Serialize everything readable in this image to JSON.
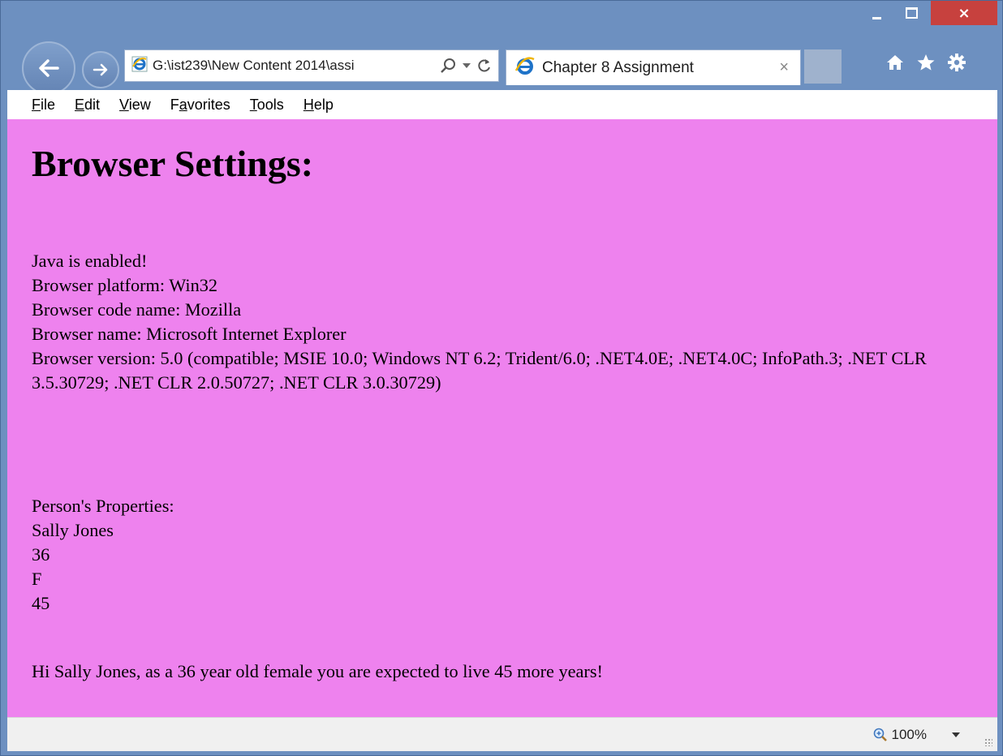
{
  "window": {
    "address": "G:\\ist239\\New Content 2014\\assi",
    "tab_title": "Chapter 8 Assignment",
    "close_glyph": "×",
    "tab_close_glyph": "×"
  },
  "menu": [
    "File",
    "Edit",
    "View",
    "Favorites",
    "Tools",
    "Help"
  ],
  "content": {
    "heading": "Browser Settings:",
    "browser_lines": [
      "Java is enabled!",
      "Browser platform: Win32",
      "Browser code name: Mozilla",
      "Browser name: Microsoft Internet Explorer",
      "Browser version: 5.0 (compatible; MSIE 10.0; Windows NT 6.2; Trident/6.0; .NET4.0E; .NET4.0C; InfoPath.3; .NET CLR 3.5.30729; .NET CLR 2.0.50727; .NET CLR 3.0.30729)"
    ],
    "person_lines": [
      "Person's Properties:",
      "Sally Jones",
      "36",
      "F",
      "45"
    ],
    "message": "Hi Sally Jones, as a 36 year old female you are expected to live 45 more years!"
  },
  "status": {
    "zoom": "100%"
  },
  "colors": {
    "page_background": "#ee82ee",
    "frame": "#6d90c0",
    "close_button": "#c7413e"
  },
  "icons": [
    "back-arrow-icon",
    "forward-arrow-icon",
    "ie-page-icon",
    "search-icon",
    "dropdown-icon",
    "refresh-icon",
    "ie-logo-icon",
    "home-icon",
    "favorites-star-icon",
    "settings-gear-icon",
    "zoom-icon"
  ]
}
